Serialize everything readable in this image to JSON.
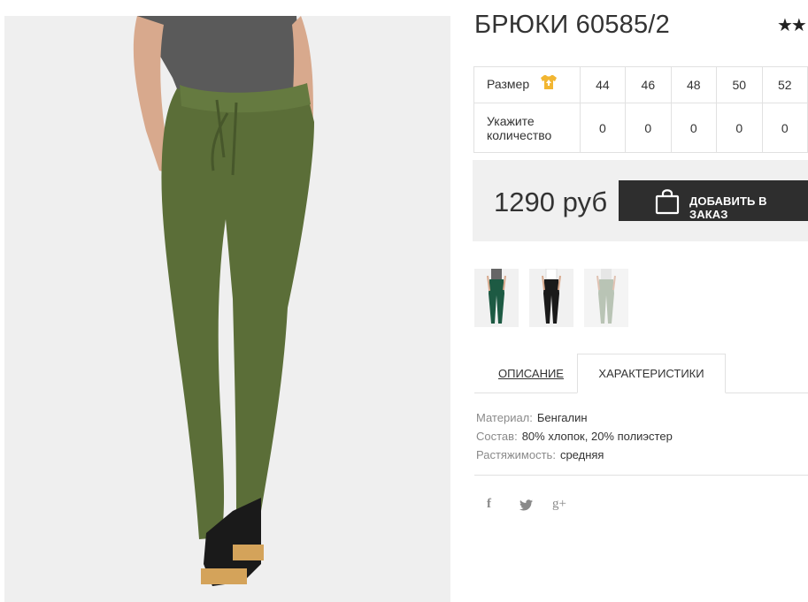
{
  "product": {
    "title": "БРЮКИ 60585/2",
    "rating_stars": "★★"
  },
  "sizes": {
    "size_label": "Размер",
    "qty_label_line1": "Укажите",
    "qty_label_line2": "количество",
    "values": [
      "44",
      "46",
      "48",
      "50",
      "52"
    ],
    "quantities": [
      "0",
      "0",
      "0",
      "0",
      "0"
    ]
  },
  "purchase": {
    "price": "1290 руб",
    "add_button_label": "ДОБАВИТЬ В ЗАКАЗ"
  },
  "thumbnails": [
    {
      "color": "green",
      "hex": "#1d5a43"
    },
    {
      "color": "black",
      "hex": "#1a1a1a"
    },
    {
      "color": "light",
      "hex": "#b9c4b5"
    }
  ],
  "tabs": {
    "description": "ОПИСАНИЕ",
    "characteristics": "ХАРАКТЕРИСТИКИ"
  },
  "specs": [
    {
      "key": "Материал:",
      "value": "Бенгалин"
    },
    {
      "key": "Состав:",
      "value": "80% хлопок, 20% полиэстер"
    },
    {
      "key": "Растяжимость:",
      "value": "средняя"
    }
  ],
  "social": {
    "facebook": "f",
    "twitter": "twitter-icon",
    "googleplus": "g+"
  },
  "colors": {
    "button_bg": "#2e2e2e",
    "price_bg": "#f0f0f0",
    "tshirt_icon": "#f2b632",
    "product_olive": "#5b6e38"
  }
}
